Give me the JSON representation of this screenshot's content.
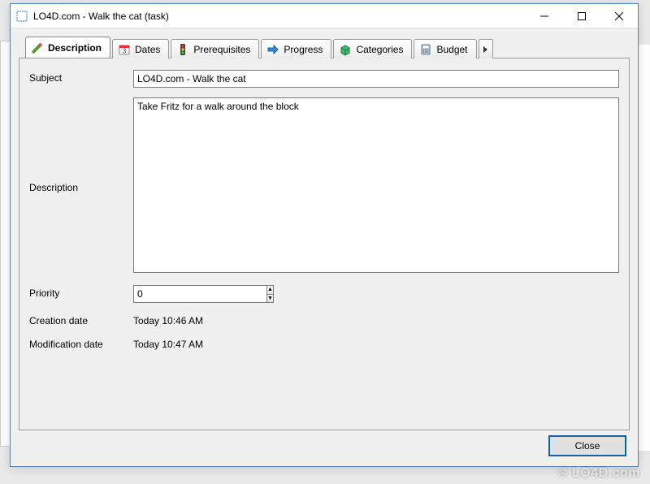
{
  "window": {
    "title": "LO4D.com - Walk the cat (task)"
  },
  "tabs": {
    "description": "Description",
    "dates": "Dates",
    "prerequisites": "Prerequisites",
    "progress": "Progress",
    "categories": "Categories",
    "budget": "Budget"
  },
  "labels": {
    "subject": "Subject",
    "description": "Description",
    "priority": "Priority",
    "creation_date": "Creation date",
    "modification_date": "Modification date"
  },
  "fields": {
    "subject": "LO4D.com - Walk the cat",
    "description": "Take Fritz for a walk around the block",
    "priority": "0",
    "creation_date": "Today 10:46 AM",
    "modification_date": "Today 10:47 AM"
  },
  "buttons": {
    "close": "Close"
  },
  "watermark": "© LO4D.com"
}
